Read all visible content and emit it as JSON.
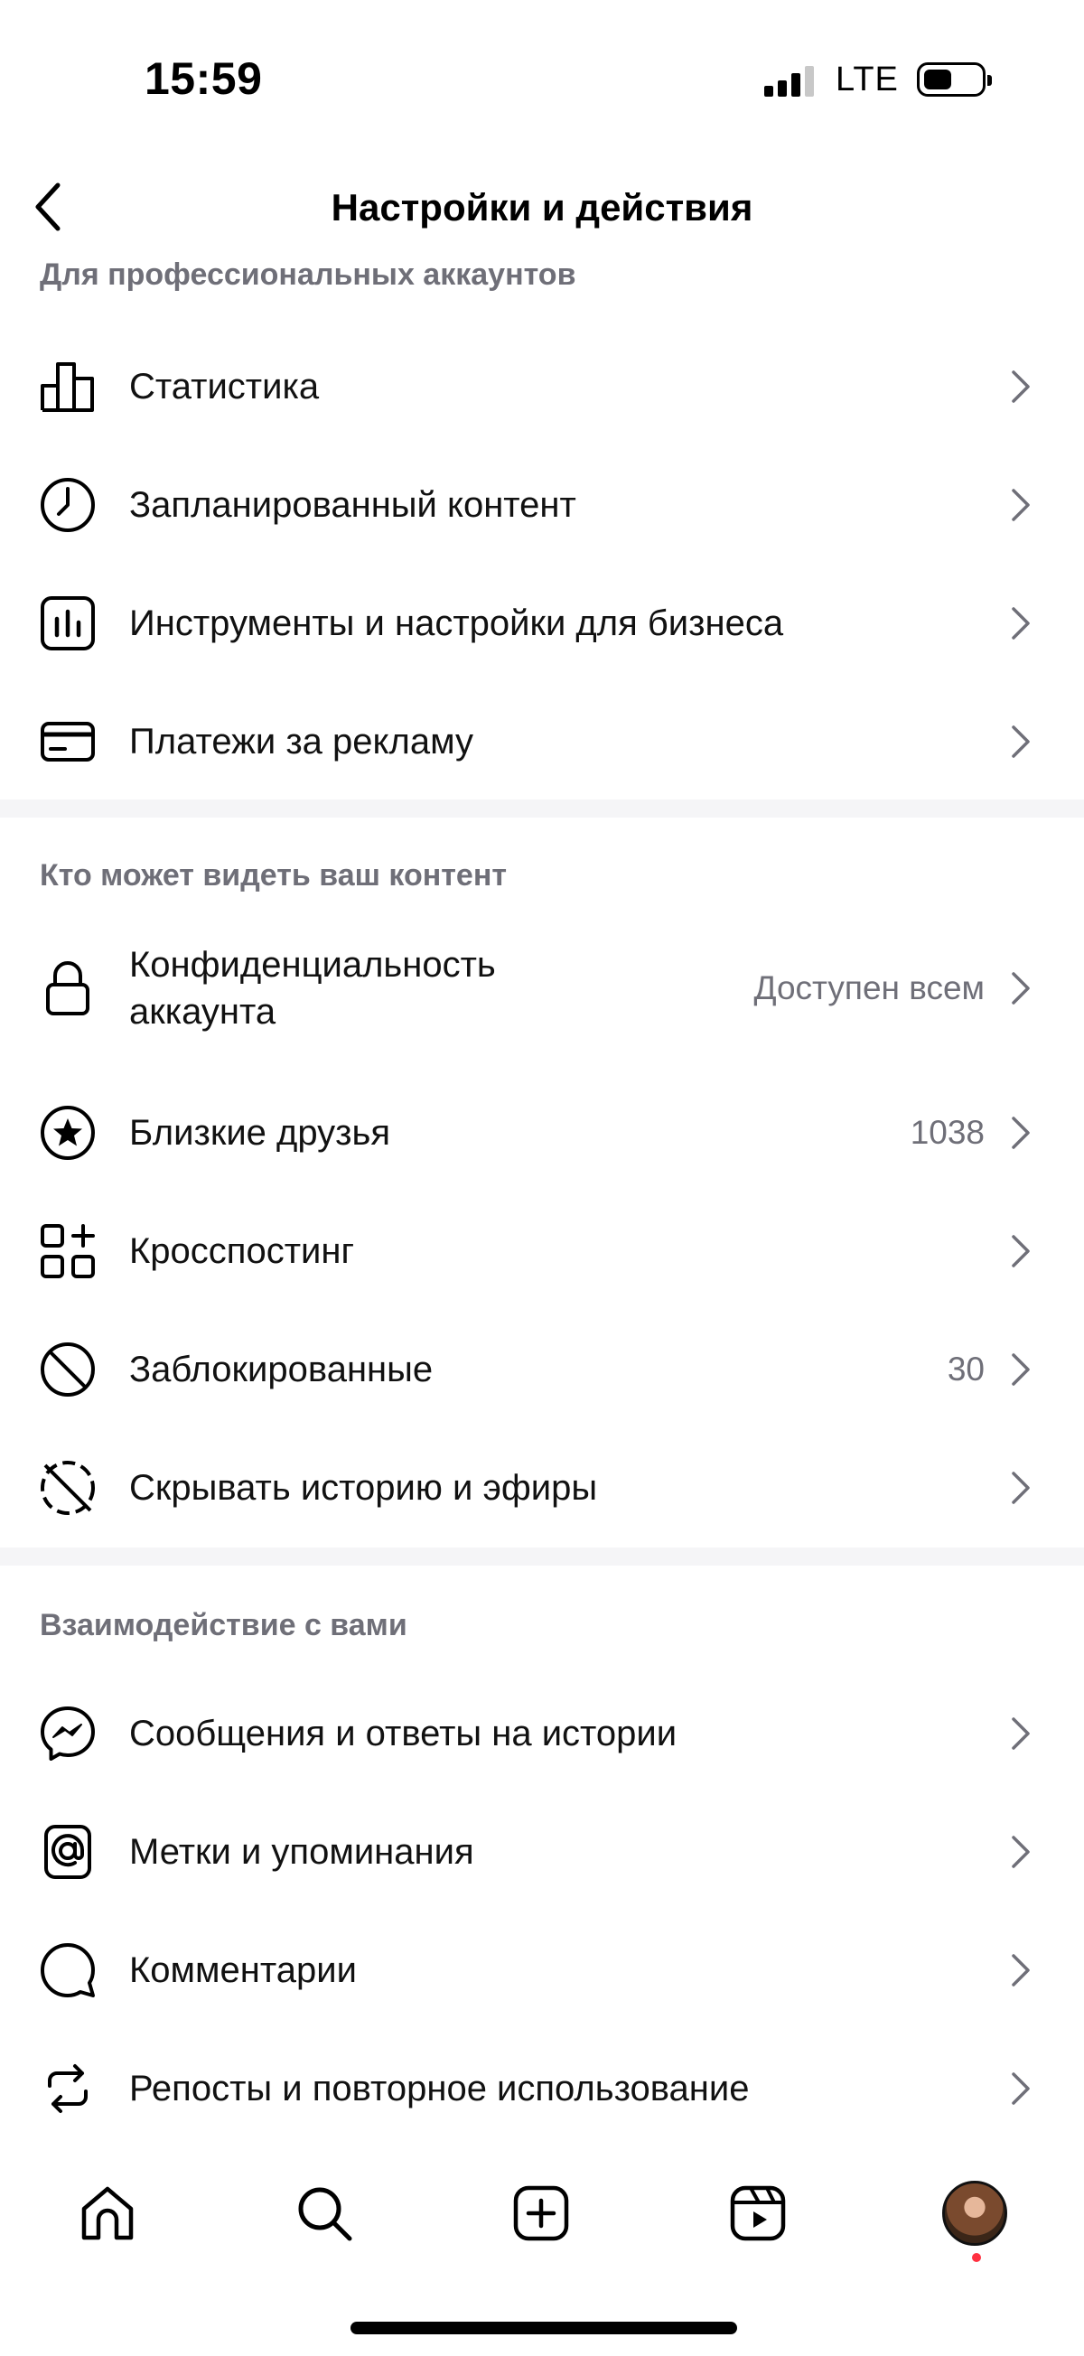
{
  "status_bar": {
    "time": "15:59",
    "network": "LTE"
  },
  "header": {
    "title": "Настройки и действия"
  },
  "sections": [
    {
      "title": "Для профессиональных аккаунтов",
      "items": [
        {
          "label": "Статистика",
          "icon": "bar-chart-icon",
          "value": ""
        },
        {
          "label": "Запланированный контент",
          "icon": "clock-icon",
          "value": ""
        },
        {
          "label": "Инструменты и настройки для бизнеса",
          "icon": "business-tools-icon",
          "value": ""
        },
        {
          "label": "Платежи за рекламу",
          "icon": "credit-card-icon",
          "value": ""
        }
      ]
    },
    {
      "title": "Кто может видеть ваш контент",
      "items": [
        {
          "label_line1": "Конфиденциальность",
          "label_line2": "аккаунта",
          "icon": "lock-icon",
          "value": "Доступен всем"
        },
        {
          "label": "Близкие друзья",
          "icon": "star-circle-icon",
          "value": "1038"
        },
        {
          "label": "Кросспостинг",
          "icon": "grid-plus-icon",
          "value": ""
        },
        {
          "label": "Заблокированные",
          "icon": "block-icon",
          "value": "30"
        },
        {
          "label": "Скрывать историю и эфиры",
          "icon": "hide-story-icon",
          "value": ""
        }
      ]
    },
    {
      "title": "Взаимодействие с вами",
      "items": [
        {
          "label": "Сообщения и ответы на истории",
          "icon": "messenger-icon",
          "value": ""
        },
        {
          "label": "Метки и упоминания",
          "icon": "at-sign-icon",
          "value": ""
        },
        {
          "label": "Комментарии",
          "icon": "comment-icon",
          "value": ""
        },
        {
          "label": "Репосты и повторное использование",
          "icon": "repost-icon",
          "value": ""
        }
      ]
    }
  ],
  "bottom_nav": [
    "home-icon",
    "search-icon",
    "create-icon",
    "reels-icon",
    "profile-avatar"
  ],
  "colors": {
    "secondary_text": "#6f6f78",
    "separator": "#f5f5f7",
    "notification": "#ff3040"
  }
}
